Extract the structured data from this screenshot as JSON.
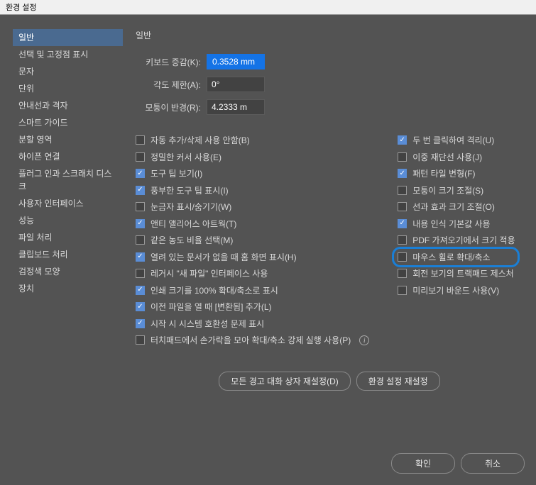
{
  "window": {
    "title": "환경 설정"
  },
  "sidebar": {
    "items": [
      {
        "label": "일반",
        "selected": true
      },
      {
        "label": "선택 및 고정점 표시",
        "selected": false
      },
      {
        "label": "문자",
        "selected": false
      },
      {
        "label": "단위",
        "selected": false
      },
      {
        "label": "안내선과 격자",
        "selected": false
      },
      {
        "label": "스마트 가이드",
        "selected": false
      },
      {
        "label": "분할 영역",
        "selected": false
      },
      {
        "label": "하이픈 연결",
        "selected": false
      },
      {
        "label": "플러그 인과 스크래치 디스크",
        "selected": false
      },
      {
        "label": "사용자 인터페이스",
        "selected": false
      },
      {
        "label": "성능",
        "selected": false
      },
      {
        "label": "파일 처리",
        "selected": false
      },
      {
        "label": "클립보드 처리",
        "selected": false
      },
      {
        "label": "검정색 모양",
        "selected": false
      },
      {
        "label": "장치",
        "selected": false
      }
    ]
  },
  "main": {
    "heading": "일반",
    "fields": {
      "keyboard_increment": {
        "label": "키보드 증감(K):",
        "value": "0.3528 mm"
      },
      "constrain_angle": {
        "label": "각도 제한(A):",
        "value": "0°"
      },
      "corner_radius": {
        "label": "모퉁이 반경(R):",
        "value": "4.2333 m"
      }
    },
    "checkboxes_left": [
      {
        "label": "자동 추가/삭제 사용 안함(B)",
        "checked": false
      },
      {
        "label": "정밀한 커서 사용(E)",
        "checked": false
      },
      {
        "label": "도구 팁 보기(I)",
        "checked": true
      },
      {
        "label": "풍부한 도구 팁 표시(I)",
        "checked": true
      },
      {
        "label": "눈금자 표시/숨기기(W)",
        "checked": false
      },
      {
        "label": "앤티 앨리어스 아트웍(T)",
        "checked": true
      },
      {
        "label": "같은 농도 비율 선택(M)",
        "checked": false
      },
      {
        "label": "열려 있는 문서가 없을 때 홈 화면 표시(H)",
        "checked": true
      },
      {
        "label": "레거시 \"새 파일\" 인터페이스 사용",
        "checked": false
      },
      {
        "label": "인쇄 크기를 100% 확대/축소로 표시",
        "checked": true
      },
      {
        "label": "이전 파일을 열 때 [변환됨] 추가(L)",
        "checked": true
      },
      {
        "label": "시작 시 시스템 호환성 문제 표시",
        "checked": true
      },
      {
        "label": "터치패드에서 손가락을 모아 확대/축소 강제 실행 사용(P)",
        "checked": false,
        "info": true
      }
    ],
    "checkboxes_right": [
      {
        "label": "두 번 클릭하여 격리(U)",
        "checked": true
      },
      {
        "label": "이중 재단선 사용(J)",
        "checked": false
      },
      {
        "label": "패턴 타일 변형(F)",
        "checked": true
      },
      {
        "label": "모퉁이 크기 조절(S)",
        "checked": false
      },
      {
        "label": "선과 효과 크기 조절(O)",
        "checked": false
      },
      {
        "label": "내용 인식 기본값 사용",
        "checked": true
      },
      {
        "label": "PDF 가져오기에서 크기 적용",
        "checked": false
      },
      {
        "label": "마우스 휠로 확대/축소",
        "checked": false,
        "highlight": true
      },
      {
        "label": "회전 보기의 트랙패드 제스처",
        "checked": false
      },
      {
        "label": "미리보기 바운드 사용(V)",
        "checked": false
      }
    ],
    "mid_buttons": {
      "reset_warnings": "모든 경고 대화 상자 재설정(D)",
      "reset_prefs": "환경 설정 재설정"
    }
  },
  "footer": {
    "ok": "확인",
    "cancel": "취소"
  }
}
